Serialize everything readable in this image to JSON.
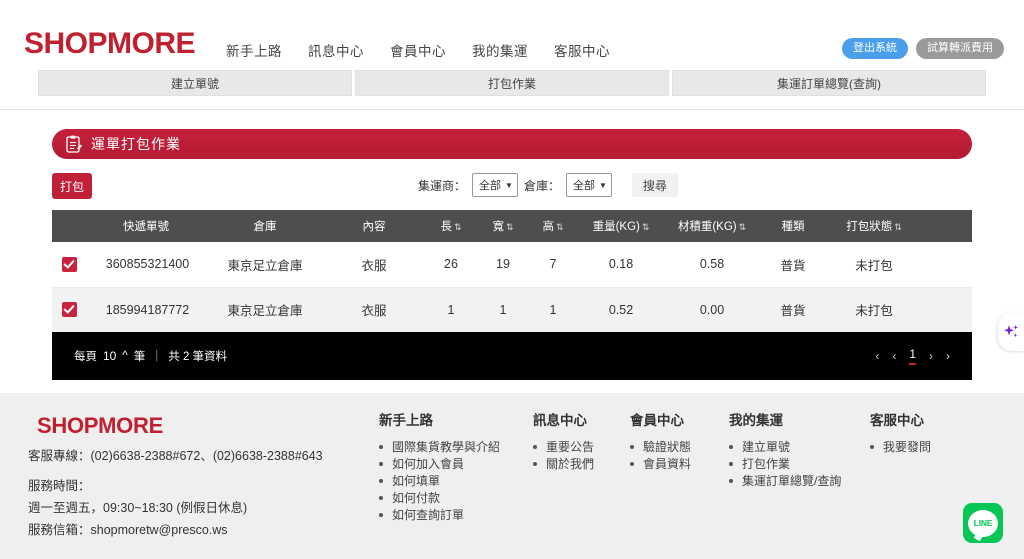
{
  "header": {
    "brand": "SHOPMORE",
    "nav": [
      {
        "label": "新手上路"
      },
      {
        "label": "訊息中心"
      },
      {
        "label": "會員中心"
      },
      {
        "label": "我的集運"
      },
      {
        "label": "客服中心"
      }
    ],
    "logout_label": "登出系統",
    "estimate_label": "試算轉派費用",
    "accent_blue": "#4a9eea",
    "accent_gray": "#9a9a9a"
  },
  "tabs": [
    {
      "label": "建立單號"
    },
    {
      "label": "打包作業"
    },
    {
      "label": "集運訂單總覽(查詢)"
    }
  ],
  "panel": {
    "banner_title": "運單打包作業",
    "banner_color": "#c5203a",
    "pack_button": "打包",
    "filters": {
      "carrier_label": "集運商：",
      "carrier_value": "全部",
      "warehouse_label": "倉庫：",
      "warehouse_value": "全部",
      "search_button": "搜尋"
    }
  },
  "table": {
    "columns": [
      {
        "label": "快遞單號",
        "sortable": false
      },
      {
        "label": "倉庫",
        "sortable": false
      },
      {
        "label": "內容",
        "sortable": false
      },
      {
        "label": "長",
        "sortable": true
      },
      {
        "label": "寬",
        "sortable": true
      },
      {
        "label": "高",
        "sortable": true
      },
      {
        "label": "重量(KG)",
        "sortable": true
      },
      {
        "label": "材積重(KG)",
        "sortable": true
      },
      {
        "label": "種類",
        "sortable": false
      },
      {
        "label": "打包狀態",
        "sortable": true
      }
    ],
    "rows": [
      {
        "checked": true,
        "tracking_no": "360855321400",
        "warehouse": "東京足立倉庫",
        "content": "衣服",
        "length": "26",
        "width": "19",
        "height": "7",
        "weight": "0.18",
        "volume_weight": "0.58",
        "category": "普貨",
        "status": "未打包"
      },
      {
        "checked": true,
        "tracking_no": "185994187772",
        "warehouse": "東京足立倉庫",
        "content": "衣服",
        "length": "1",
        "width": "1",
        "height": "1",
        "weight": "0.52",
        "volume_weight": "0.00",
        "category": "普貨",
        "status": "未打包"
      }
    ],
    "footer": {
      "per_page_label": "每頁",
      "per_page_value": "10",
      "per_page_unit": "筆",
      "divider": "|",
      "total_text": "共 2 筆資料",
      "pager": {
        "first": "‹",
        "prev": "‹",
        "current": "1",
        "next": "›",
        "last": "›"
      }
    }
  },
  "assistant": {
    "icon": "sparkle-icon",
    "color": "#7a22d6"
  },
  "footer": {
    "brand": "SHOPMORE",
    "hotline": "客服專線：(02)6638-2388#672、(02)6638-2388#643",
    "hours_label": "服務時間：",
    "hours_value": "週一至週五，09:30~18:30 (例假日休息)",
    "email": "服務信箱：shopmoretw@presco.ws",
    "columns": [
      {
        "title": "新手上路",
        "items": [
          "國際集貨教學與介紹",
          "如何加入會員",
          "如何填單",
          "如何付款",
          "如何查詢訂單"
        ]
      },
      {
        "title": "訊息中心",
        "items": [
          "重要公告",
          "關於我們"
        ]
      },
      {
        "title": "會員中心",
        "items": [
          "驗證狀態",
          "會員資料"
        ]
      },
      {
        "title": "我的集運",
        "items": [
          "建立單號",
          "打包作業",
          "集運訂單總覽/查詢"
        ]
      },
      {
        "title": "客服中心",
        "items": [
          "我要發問"
        ]
      }
    ],
    "line_button_label": "LINE",
    "line_color": "#06c755"
  }
}
